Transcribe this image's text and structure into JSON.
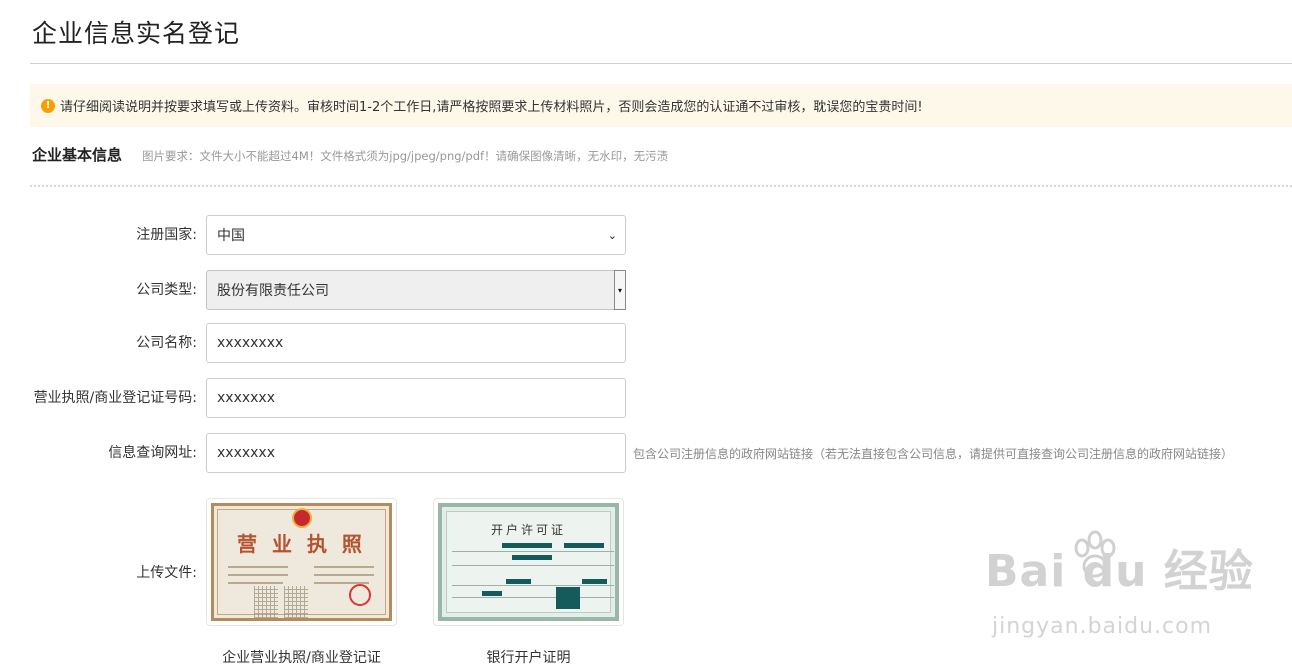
{
  "page": {
    "title": "企业信息实名登记"
  },
  "notice": {
    "icon": "warning-icon",
    "text": "请仔细阅读说明并按要求填写或上传资料。审核时间1-2个工作日,请严格按照要求上传材料照片，否则会造成您的认证通不过审核，耽误您的宝贵时间!"
  },
  "section": {
    "title": "企业基本信息",
    "hint": "图片要求：文件大小不能超过4M！文件格式须为jpg/jpeg/png/pdf！请确保图像清晰，无水印，无污渍"
  },
  "form": {
    "country": {
      "label": "注册国家:",
      "value": "中国"
    },
    "company_type": {
      "label": "公司类型:",
      "value": "股份有限责任公司"
    },
    "company_name": {
      "label": "公司名称:",
      "value": "xxxxxxxx"
    },
    "license_no": {
      "label": "营业执照/商业登记证号码:",
      "value": "xxxxxxx"
    },
    "query_url": {
      "label": "信息查询网址:",
      "value": "xxxxxxx",
      "hint": "包含公司注册信息的政府网站链接（若无法直接包含公司信息，请提供可直接查询公司注册信息的政府网站链接）"
    }
  },
  "upload": {
    "label": "上传文件:",
    "files": [
      {
        "caption": "企业营业执照/商业登记证",
        "doc_title": "营 业 执 照"
      },
      {
        "caption": "银行开户证明",
        "doc_title": "开户许可证"
      }
    ]
  },
  "watermark": {
    "main": "Bai du 经验",
    "sub": "jingyan.baidu.com"
  },
  "colors": {
    "notice_bg": "#fdf8e9",
    "notice_icon": "#f5a000",
    "disabled_bg": "#efefef"
  }
}
